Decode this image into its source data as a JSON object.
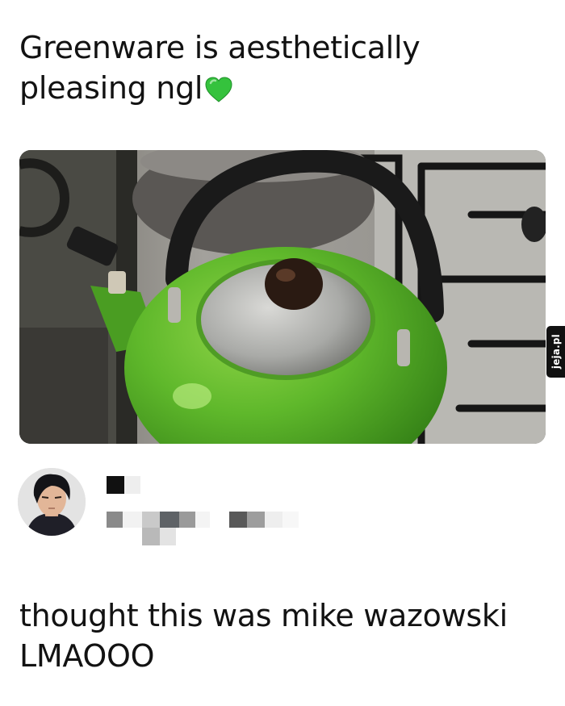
{
  "post": {
    "top_text": "Greenware is aesthetically pleasing ngl",
    "top_emoji": "green-heart-icon",
    "photo_subject": "green-kettle-photo",
    "watermark": "jeja.pl",
    "reply_text": "thought this was mike wazowski LMAOOO"
  },
  "author": {
    "avatar": "avatar",
    "name": "",
    "handle": ""
  },
  "colors": {
    "text": "#121212",
    "heart": "#35c23d",
    "kettle": "#5fb82b"
  }
}
